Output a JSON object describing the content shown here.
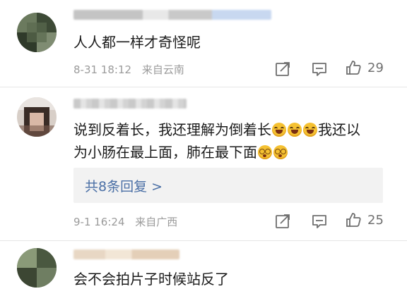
{
  "comments": [
    {
      "text": "人人都一样才奇怪呢",
      "date": "8-31 18:12",
      "location": "来自云南",
      "likes": "29"
    },
    {
      "text_part1": "说到反着长，我还理解为倒着长",
      "text_part2": "我还以",
      "text_line2": "为小肠在最上面，肺在最下面",
      "emoji_laugh": "laughing-tears-emoji",
      "emoji_dizzy": "dizzy-eyes-emoji",
      "replies_label": "共8条回复 >",
      "date": "9-1 16:24",
      "location": "来自广西",
      "likes": "25"
    },
    {
      "text": "会不会拍片子时候站反了"
    }
  ],
  "icons": {
    "share": "share-edit-icon",
    "comment": "comment-icon",
    "like": "thumbs-up-icon"
  },
  "colors": {
    "link": "#4a6fa5",
    "meta": "#9b9b9b",
    "reply_bg": "#f2f2f2"
  }
}
